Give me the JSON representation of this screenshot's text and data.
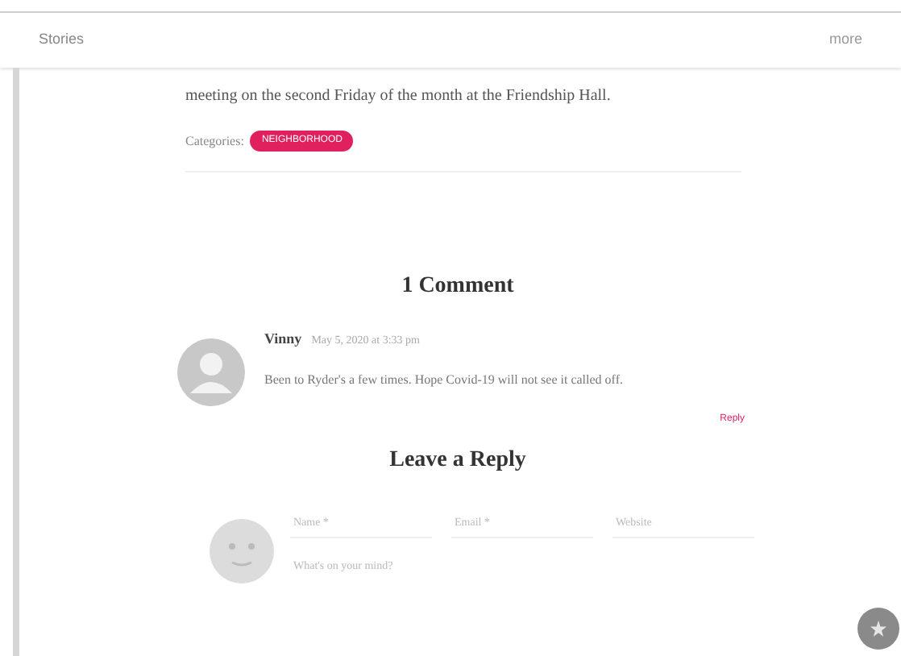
{
  "header": {
    "title": "Stories",
    "action": "more"
  },
  "post": {
    "text": "meeting on the second Friday of the month at the Friendship Hall.",
    "categories_label": "Categories:",
    "category": "NEIGHBORHOOD"
  },
  "comments": {
    "title": "1 Comment",
    "items": [
      {
        "author": "Vinny",
        "date": "May 5, 2020 at 3:33 pm",
        "text": "Been to Ryder's a few times. Hope Covid-19 will not see it called off.",
        "reply": "Reply"
      }
    ]
  },
  "reply_form": {
    "title": "Leave a Reply",
    "fields": [
      {
        "placeholder": "Name *"
      },
      {
        "placeholder": "Email *"
      },
      {
        "placeholder": "Website"
      }
    ],
    "message": {
      "placeholder": "What's on your mind?"
    }
  }
}
